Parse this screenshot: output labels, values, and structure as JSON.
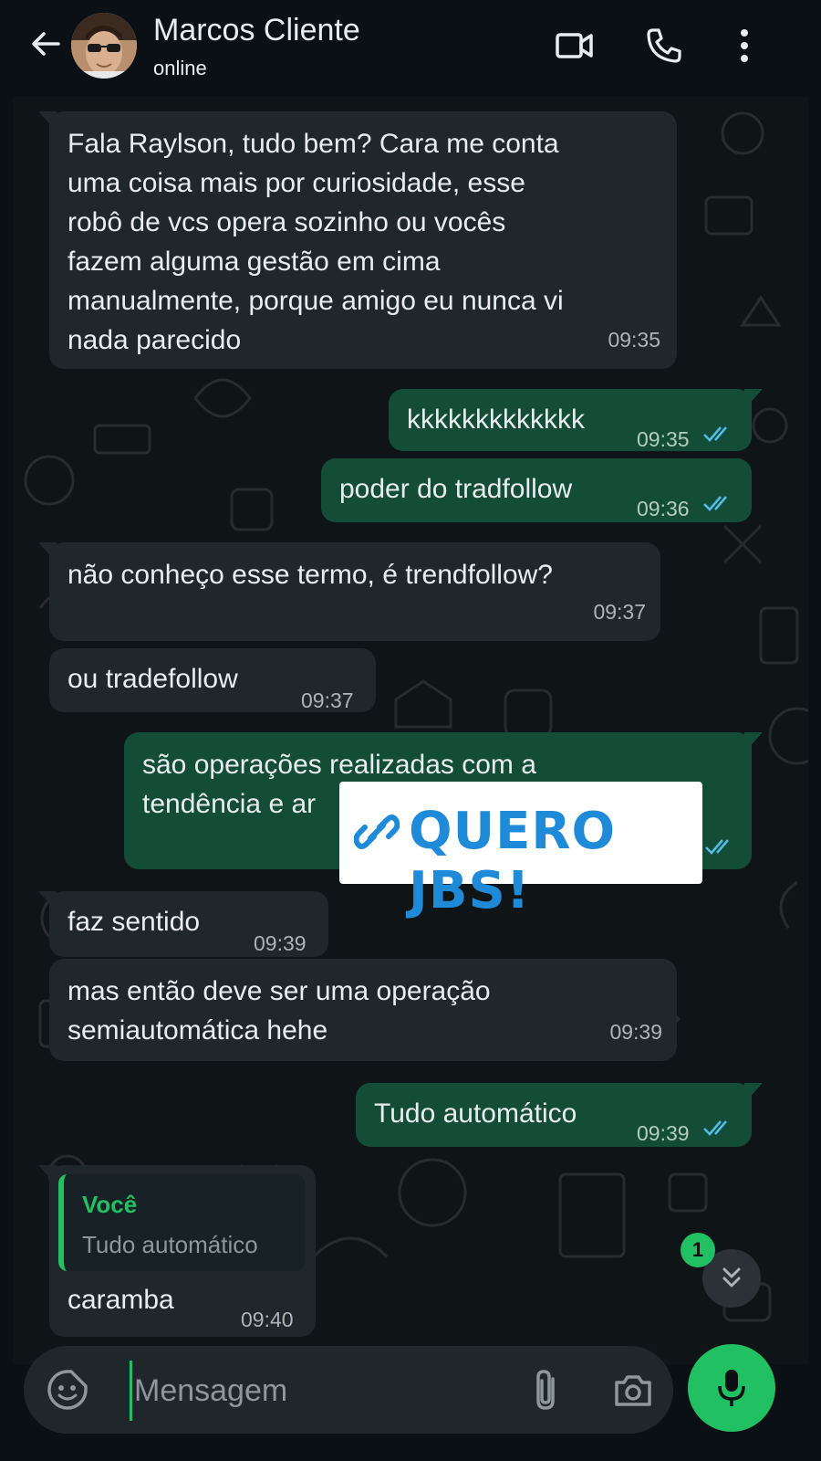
{
  "header": {
    "contact_name": "Marcos Cliente",
    "status": "online",
    "icons": [
      "back-arrow-icon",
      "video-call-icon",
      "voice-call-icon",
      "more-options-icon"
    ]
  },
  "messages": [
    {
      "dir": "in",
      "text": "Fala Raylson, tudo bem? Cara me conta\numa coisa mais por curiosidade, esse\nrobô de vcs opera sozinho ou vocês\nfazem alguma gestão em cima\nmanualmente, porque amigo eu nunca vi\nnada parecido",
      "time": "09:35"
    },
    {
      "dir": "out",
      "text": "kkkkkkkkkkkkk",
      "time": "09:35",
      "read": true
    },
    {
      "dir": "out",
      "text": "poder do tradfollow",
      "time": "09:36",
      "read": true
    },
    {
      "dir": "in",
      "text": "não conheço esse termo, é trendfollow?",
      "time": "09:37"
    },
    {
      "dir": "in",
      "text": "ou tradefollow",
      "time": "09:37"
    },
    {
      "dir": "out",
      "text": "são operações realizadas com a\ntendência e ar",
      "time": "",
      "read": true
    },
    {
      "dir": "in",
      "text": "faz sentido",
      "time": "09:39"
    },
    {
      "dir": "in",
      "text": "mas então deve ser uma operação\nsemiautomática hehe",
      "time": "09:39"
    },
    {
      "dir": "out",
      "text": "Tudo automático",
      "time": "09:39",
      "read": true
    },
    {
      "dir": "in",
      "text": "caramba",
      "time": "09:40",
      "reply": {
        "author": "Você",
        "text": "Tudo automático"
      }
    }
  ],
  "banner": {
    "text": "QUERO JBS!",
    "icon": "link-icon"
  },
  "scroll": {
    "unread_count": "1",
    "icon": "double-chevron-down-icon"
  },
  "composer": {
    "placeholder": "Mensagem",
    "icons": [
      "emoji-sticker-icon",
      "attach-clip-icon",
      "camera-icon",
      "microphone-icon"
    ]
  },
  "colors": {
    "background": "#0b1014",
    "incoming_bubble": "#1f272a",
    "outgoing_bubble": "#134d37",
    "accent_green": "#21c063",
    "read_ticks": "#53bdeb",
    "banner_text": "#1e8ad8"
  }
}
